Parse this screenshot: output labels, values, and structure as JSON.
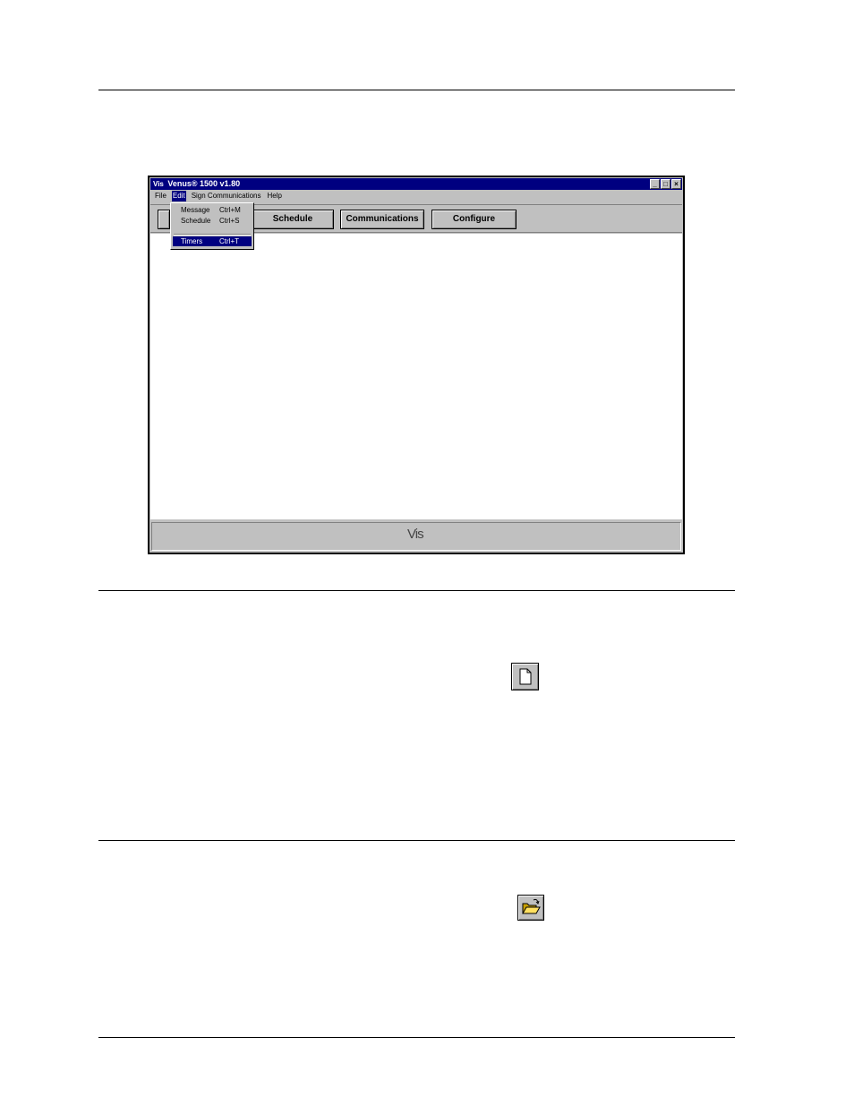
{
  "window": {
    "logo": "Vis",
    "title": "Venus® 1500 v1.80",
    "controls": {
      "minimize": "_",
      "maximize": "□",
      "close": "×"
    }
  },
  "menubar": {
    "items": [
      "File",
      "Edit",
      "Sign Communications",
      "Help"
    ]
  },
  "edit_menu": {
    "items": [
      {
        "label": "Message",
        "shortcut": "Ctrl+M"
      },
      {
        "label": "Schedule",
        "shortcut": "Ctrl+S"
      },
      {
        "label": "Timers",
        "shortcut": "Ctrl+T"
      }
    ]
  },
  "toolbar": {
    "buttons": [
      "Schedule",
      "Communications",
      "Configure"
    ]
  },
  "statusbar": {
    "logo": "Vis"
  },
  "icons": {
    "new_file": "new-file-icon",
    "open_folder": "open-folder-icon"
  }
}
